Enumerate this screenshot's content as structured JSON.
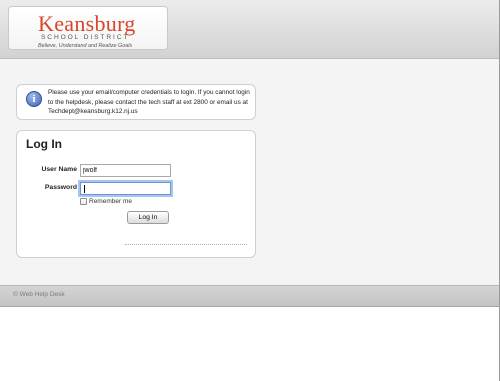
{
  "header": {
    "logo": {
      "name": "Keansburg",
      "subtitle": "SCHOOL DISTRICT",
      "tagline": "Believe, Understand and Realize Goals"
    }
  },
  "info": {
    "icon": "info-icon",
    "message": "Please use your email/computer credentials to login. If you cannot login to the helpdesk, please contact the tech staff at ext 2800 or email us at Techdept@keansburg.k12.nj.us"
  },
  "login": {
    "title": "Log In",
    "username_label": "User Name",
    "username_value": "jwolf",
    "password_label": "Password",
    "password_value": "",
    "remember_label": "Remember me",
    "remember_checked": false,
    "submit_label": "Log In"
  },
  "footer": {
    "text": "© Web Help Desk"
  },
  "colors": {
    "brand": "#d7462b",
    "info_icon": "#3f66b8",
    "focus_ring": "#a8c4f2"
  }
}
